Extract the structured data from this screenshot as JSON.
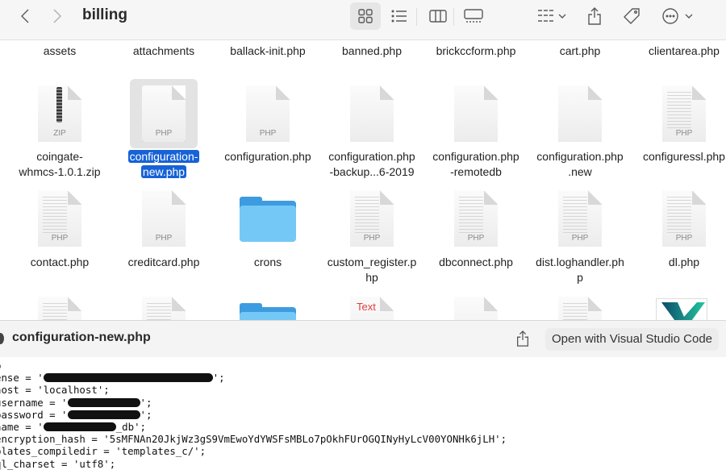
{
  "window": {
    "folder_title": "billing"
  },
  "toolbar": {
    "back": "back-icon",
    "forward": "forward-icon",
    "views": [
      "icon-view",
      "list-view",
      "column-view",
      "gallery-view"
    ],
    "group": "group-icon",
    "share": "share-icon",
    "tag": "tag-icon",
    "more": "more-icon"
  },
  "files_row0": [
    "assets",
    "attachments",
    "ballack-init.php",
    "banned.php",
    "brickccform.php",
    "cart.php",
    "clientarea.php"
  ],
  "files_row1": [
    {
      "name": "coingate-\nwhmcs-1.0.1.zip",
      "type": "ZIP"
    },
    {
      "name": "configuration-\nnew.php",
      "type": "PHP",
      "selected": true
    },
    {
      "name": "configuration.php",
      "type": "PHP"
    },
    {
      "name": "configuration.php\n-backup...6-2019",
      "type": ""
    },
    {
      "name": "configuration.php\n-remotedb",
      "type": ""
    },
    {
      "name": "configuration.php\n.new",
      "type": ""
    },
    {
      "name": "configuressl.php",
      "type": "PHP"
    }
  ],
  "files_row2": [
    {
      "name": "contact.php",
      "type": "PHP"
    },
    {
      "name": "creditcard.php",
      "type": "PHP"
    },
    {
      "name": "crons",
      "type": "folder"
    },
    {
      "name": "custom_register.p\nhp",
      "type": "PHP"
    },
    {
      "name": "dbconnect.php",
      "type": "PHP"
    },
    {
      "name": "dist.loghandler.ph\np",
      "type": "PHP"
    },
    {
      "name": "dl.php",
      "type": "PHP"
    }
  ],
  "files_row3_badge": "Text",
  "quicklook": {
    "title": "configuration-new.php",
    "open_button": "Open with Visual Studio Code",
    "code": [
      {
        "pre": "p",
        "redacted": false
      },
      {
        "pre": "ense = '",
        "redacted": true,
        "post": "';"
      },
      {
        "pre": "host = 'localhost';",
        "redacted": false
      },
      {
        "pre": "username = '",
        "redacted": true,
        "post": "';"
      },
      {
        "pre": "password = '",
        "redacted": true,
        "post": "';"
      },
      {
        "pre": "name = '",
        "redacted": true,
        "post": "_db';"
      },
      {
        "pre": "encryption_hash = '5sMFNAn20JkjWz3gS9VmEwoYdYWSFsMBLo7pOkhFUrOGQINyHyLcV00YONHk6jLH';",
        "redacted": false
      },
      {
        "pre": "plates_compiledir = 'templates_c/';",
        "redacted": false
      },
      {
        "pre": "ql_charset = 'utf8';",
        "redacted": false
      }
    ]
  }
}
